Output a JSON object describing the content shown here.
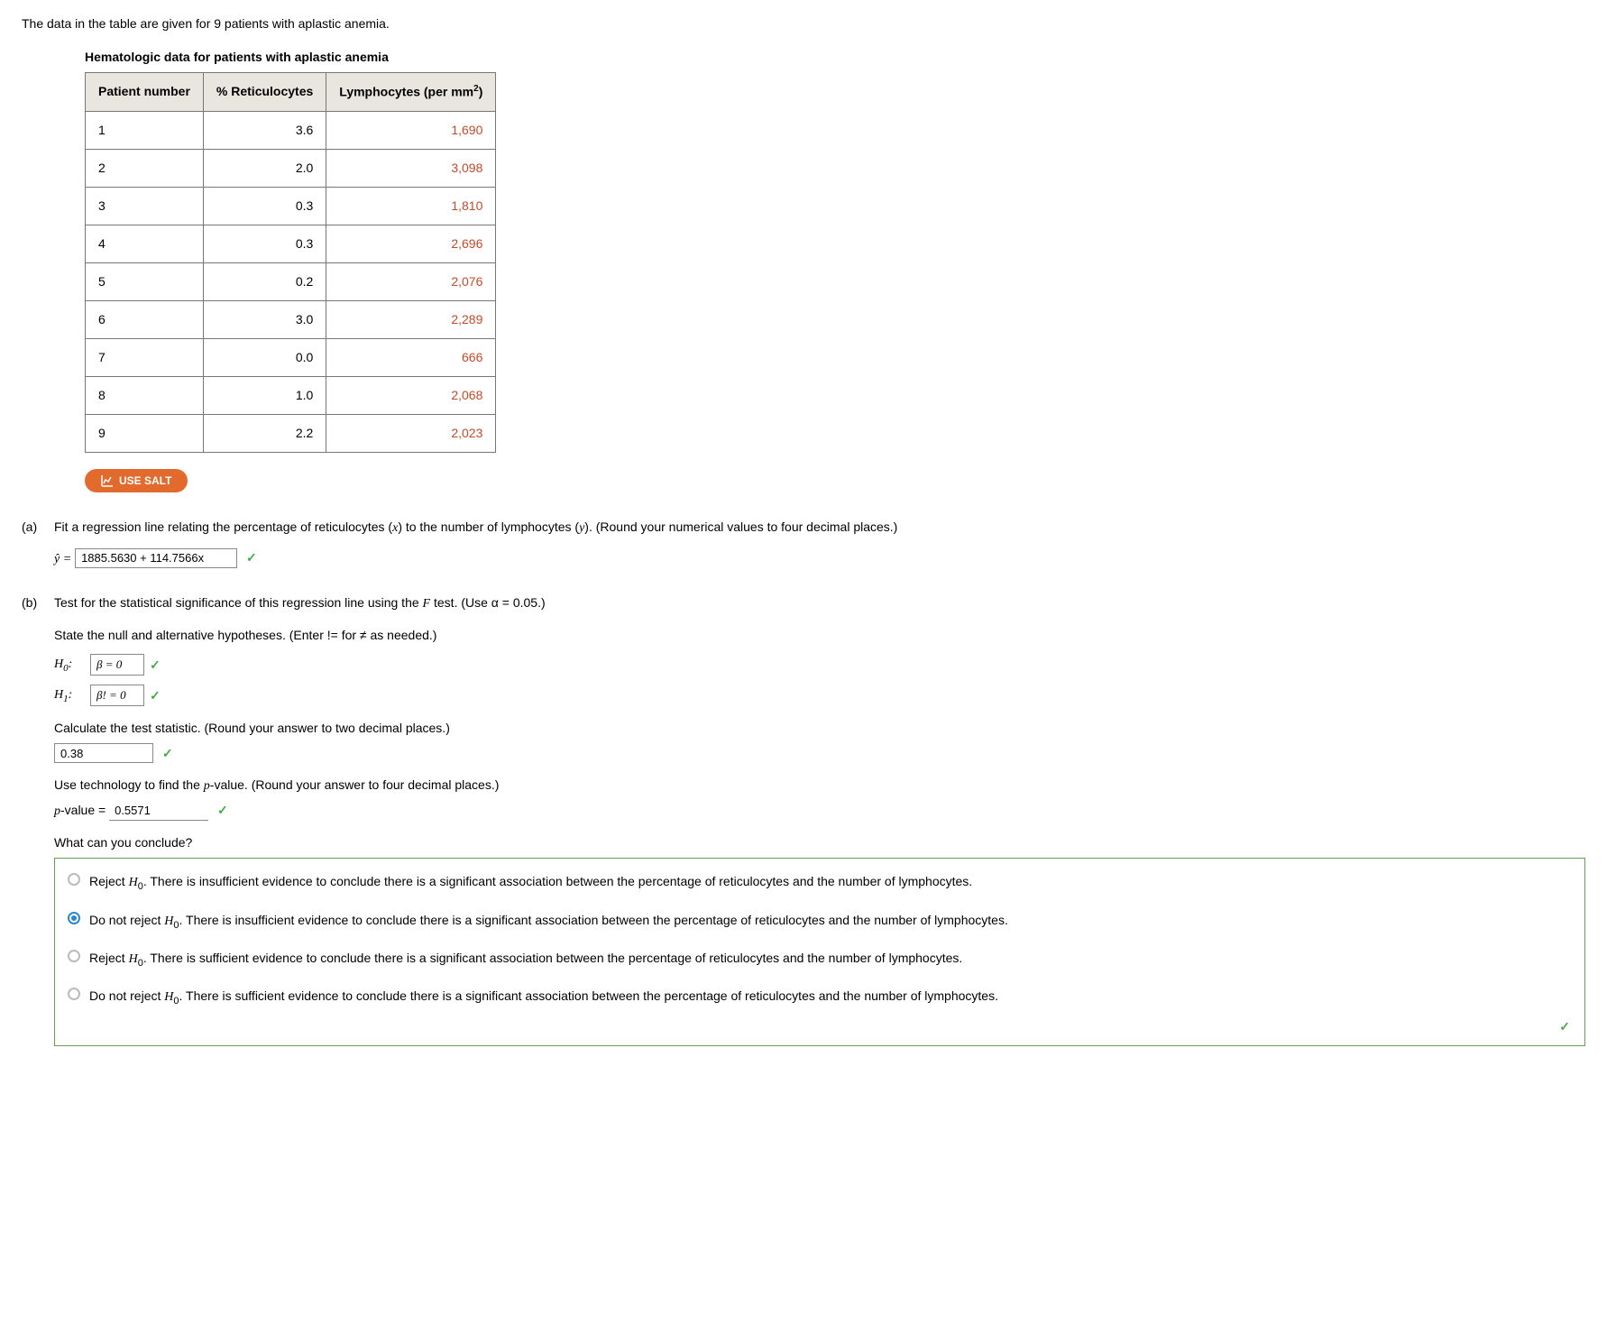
{
  "intro": "The data in the table are given for 9 patients with aplastic anemia.",
  "table_title": "Hematologic data for patients with aplastic anemia",
  "headers": {
    "c1": "Patient number",
    "c2": "% Reticulocytes",
    "c3_prefix": "Lymphocytes (per mm",
    "c3_sup": "2",
    "c3_suffix": ")"
  },
  "rows": [
    {
      "p": "1",
      "r": "3.6",
      "l": "1,690"
    },
    {
      "p": "2",
      "r": "2.0",
      "l": "3,098"
    },
    {
      "p": "3",
      "r": "0.3",
      "l": "1,810"
    },
    {
      "p": "4",
      "r": "0.3",
      "l": "2,696"
    },
    {
      "p": "5",
      "r": "0.2",
      "l": "2,076"
    },
    {
      "p": "6",
      "r": "3.0",
      "l": "2,289"
    },
    {
      "p": "7",
      "r": "0.0",
      "l": "666"
    },
    {
      "p": "8",
      "r": "1.0",
      "l": "2,068"
    },
    {
      "p": "9",
      "r": "2.2",
      "l": "2,023"
    }
  ],
  "salt_label": "USE SALT",
  "a": {
    "label": "(a)",
    "prompt_prefix": "Fit a regression line relating the percentage of reticulocytes (",
    "prompt_mid1": ") to the number of lymphocytes (",
    "prompt_suffix": "). (Round your numerical values to four decimal places.)",
    "yhat": "ŷ =",
    "input": "1885.5630 + 114.7566x"
  },
  "b": {
    "label": "(b)",
    "prompt_prefix": "Test for the statistical significance of this regression line using the ",
    "prompt_suffix": " test. (Use α = 0.05.)",
    "hyp_intro": "State the null and alternative hypotheses. (Enter != for ≠ as needed.)",
    "h0_label_prefix": "H",
    "h0_sub": "0",
    "h0_colon": ":",
    "h0_val": "β = 0",
    "h1_sub": "1",
    "h1_val": "β! = 0",
    "stat_prompt": "Calculate the test statistic. (Round your answer to two decimal places.)",
    "stat_val": "0.38",
    "pval_prompt_prefix": "Use technology to find the ",
    "pval_prompt_suffix": "-value. (Round your answer to four decimal places.)",
    "pval_label_prefix": "p",
    "pval_label_suffix": "-value = ",
    "pval_val": "0.5571",
    "conclude_q": "What can you conclude?",
    "options": [
      "Reject H₀. There is insufficient evidence to conclude there is a significant association between the percentage of reticulocytes and the number of lymphocytes.",
      "Do not reject H₀. There is insufficient evidence to conclude there is a significant association between the percentage of reticulocytes and the number of lymphocytes.",
      "Reject H₀. There is sufficient evidence to conclude there is a significant association between the percentage of reticulocytes and the number of lymphocytes.",
      "Do not reject H₀. There is sufficient evidence to conclude there is a significant association between the percentage of reticulocytes and the number of lymphocytes."
    ],
    "selected_index": 1
  },
  "chart_data": {
    "type": "table",
    "title": "Hematologic data for patients with aplastic anemia",
    "columns": [
      "Patient number",
      "% Reticulocytes",
      "Lymphocytes (per mm^2)"
    ],
    "rows": [
      [
        1,
        3.6,
        1690
      ],
      [
        2,
        2.0,
        3098
      ],
      [
        3,
        0.3,
        1810
      ],
      [
        4,
        0.3,
        2696
      ],
      [
        5,
        0.2,
        2076
      ],
      [
        6,
        3.0,
        2289
      ],
      [
        7,
        0.0,
        666
      ],
      [
        8,
        1.0,
        2068
      ],
      [
        9,
        2.2,
        2023
      ]
    ]
  }
}
